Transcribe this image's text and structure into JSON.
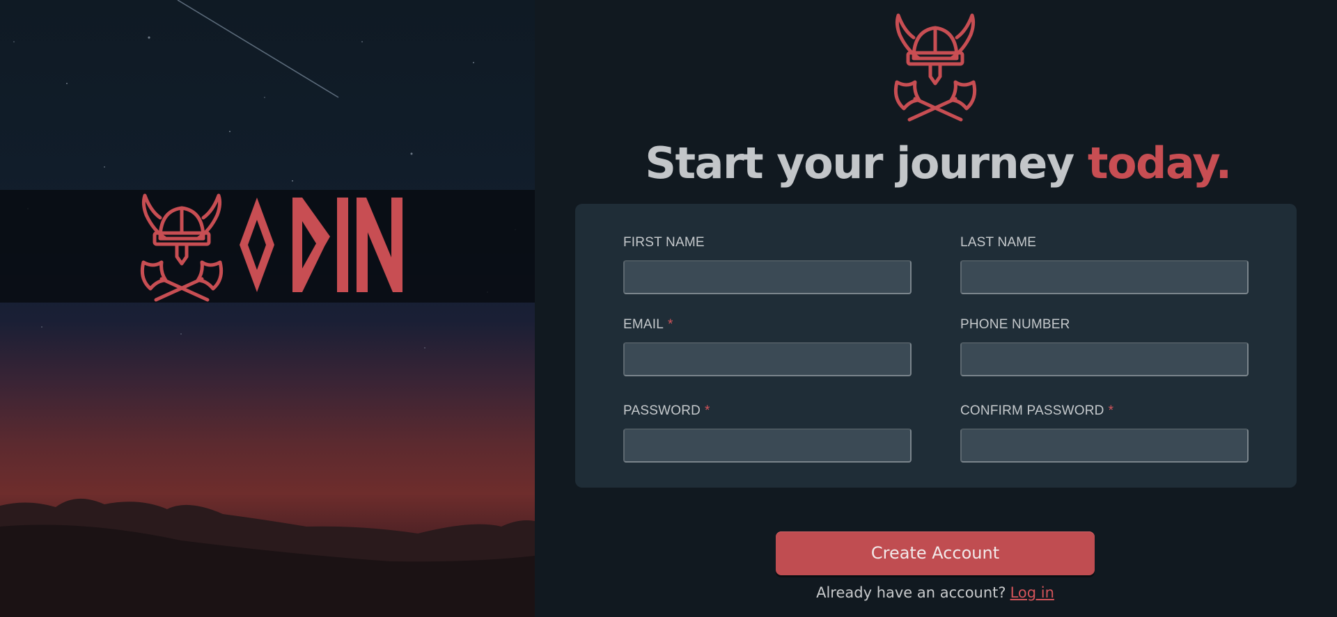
{
  "brand": {
    "name": "ODIN",
    "logo_icon": "viking-helmet-crossed-axes-icon",
    "accent_color": "#c84e53"
  },
  "headline": {
    "text": "Start your journey",
    "accent": "today."
  },
  "form": {
    "required_marker": "*",
    "fields": [
      {
        "label": "FIRST NAME",
        "required": false,
        "value": "",
        "type": "text"
      },
      {
        "label": "LAST NAME",
        "required": false,
        "value": "",
        "type": "text"
      },
      {
        "label": "EMAIL",
        "required": true,
        "value": "",
        "type": "email"
      },
      {
        "label": "PHONE NUMBER",
        "required": false,
        "value": "",
        "type": "tel"
      },
      {
        "label": "PASSWORD",
        "required": true,
        "value": "",
        "type": "password"
      },
      {
        "label": "CONFIRM PASSWORD",
        "required": true,
        "value": "",
        "type": "password"
      }
    ]
  },
  "actions": {
    "create_account_label": "Create Account",
    "login_prompt": "Already have an account?",
    "login_link": "Log in"
  }
}
